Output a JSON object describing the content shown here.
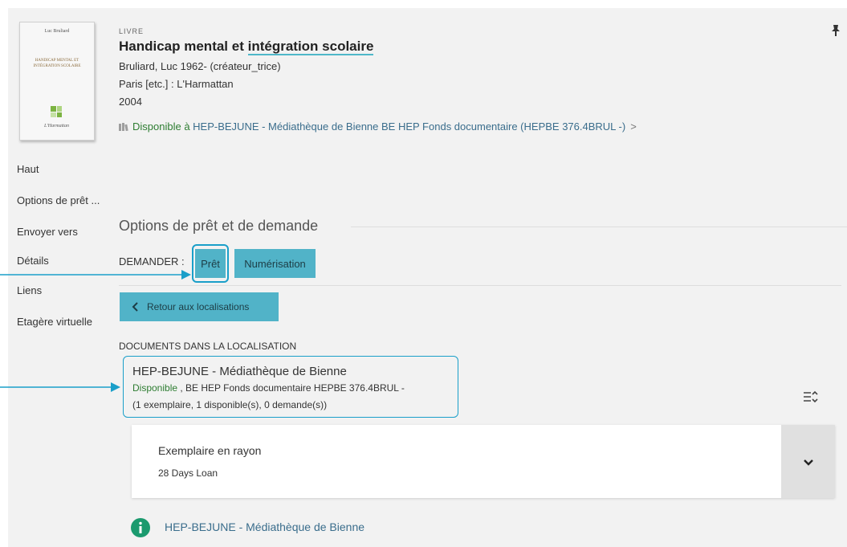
{
  "record": {
    "type": "LIVRE",
    "title_part1": "Handicap mental et ",
    "title_part2": "intégration scolaire",
    "author": "Bruliard, Luc 1962- (créateur_trice)",
    "publisher": "Paris [etc.] : L'Harmattan",
    "year": "2004",
    "availability_status": "Disponible à ",
    "availability_location": "HEP-BEJUNE - Médiathèque de Bienne  BE HEP Fonds documentaire (HEPBE 376.4BRUL -)",
    "availability_chevron": ">"
  },
  "cover": {
    "author": "Luc Bruliard",
    "title": "HANDICAP MENTAL ET INTÉGRATION SCOLAIRE",
    "publisher": "L'Harmattan"
  },
  "nav": {
    "items": [
      "Haut",
      "Options de prêt ...",
      "Envoyer vers",
      "Détails",
      "Liens",
      "Etagère virtuelle"
    ]
  },
  "options": {
    "section_title": "Options de prêt et de demande",
    "demander_label": "DEMANDER :",
    "pret_button": "Prêt",
    "numerisation_button": "Numérisation",
    "back_button": "Retour aux localisations",
    "documents_label": "DOCUMENTS DANS LA LOCALISATION"
  },
  "location": {
    "name": "HEP-BEJUNE - Médiathèque de Bienne",
    "status": "Disponible",
    "details": " , BE HEP Fonds documentaire HEPBE 376.4BRUL -",
    "counts": "(1 exemplaire, 1 disponible(s), 0 demande(s))"
  },
  "item": {
    "title": "Exemplaire en rayon",
    "policy": "28 Days Loan"
  },
  "info": {
    "text": "HEP-BEJUNE - Médiathèque de Bienne"
  },
  "colors": {
    "teal_button": "#51b3c8",
    "annotation": "#1a9fc9",
    "available_green": "#2e7d32",
    "link_blue": "#3a6d8c",
    "info_green": "#1b9a6e"
  },
  "icons": [
    "pin-icon",
    "book-icon",
    "chevron-left-icon",
    "sort-icon",
    "chevron-down-icon",
    "info-icon"
  ]
}
